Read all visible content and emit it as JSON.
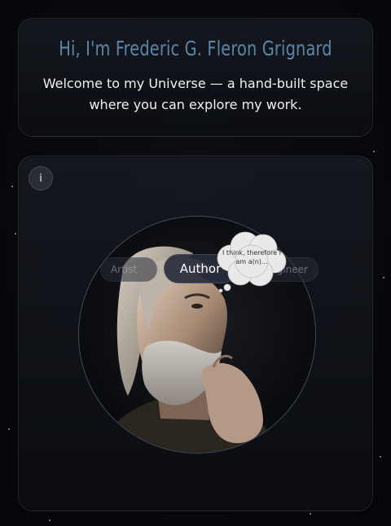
{
  "hero": {
    "title": "Hi, I'm Frederic G. Fleron Grignard",
    "subtitle": "Welcome to my Universe — a hand-built space where you can explore my work."
  },
  "universe": {
    "info_label": "i",
    "roles": {
      "left": "Artist",
      "active": "Author",
      "right": "Engineer"
    },
    "thought": "I think, therefore I am a(n)..."
  },
  "colors": {
    "title": "#5a86a8",
    "background": "#07080c",
    "orbit_ring": "#6e87a0"
  }
}
